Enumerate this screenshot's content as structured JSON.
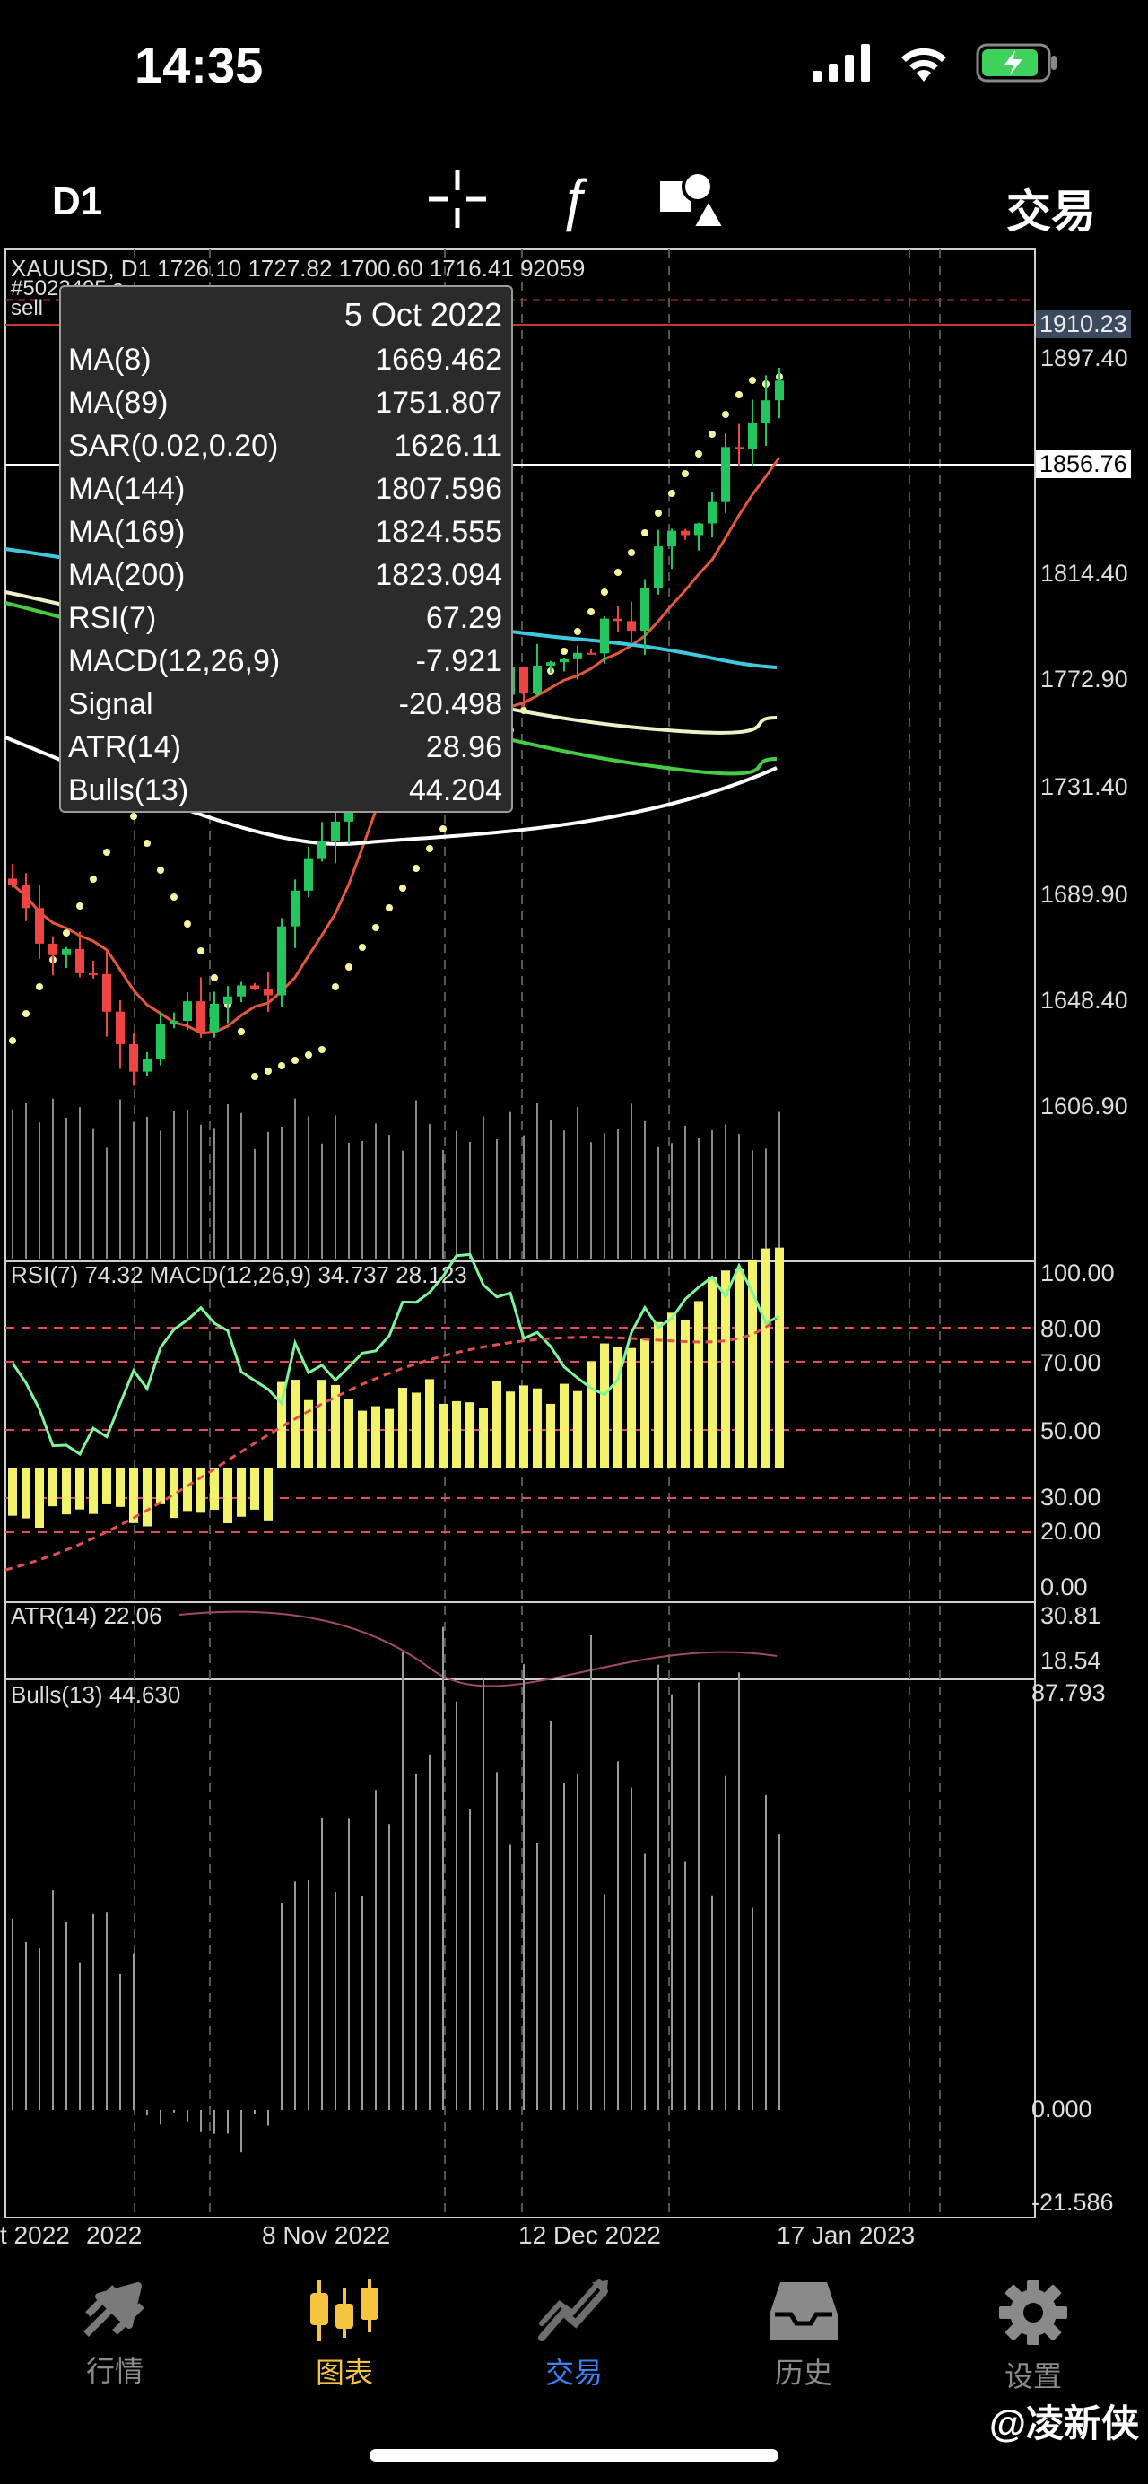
{
  "status": {
    "time": "14:35"
  },
  "toolbar": {
    "timeframe": "D1",
    "trade": "交易"
  },
  "chart": {
    "header": "XAUUSD, D1  1726.10 1727.82 1700.60 1716.41 92059",
    "header2": "#5023495 s",
    "header3": "sell",
    "price_labels": [
      "1910.23",
      "1897.40",
      "1856.76",
      "1814.40",
      "1772.90",
      "1731.40",
      "1689.90",
      "1648.40",
      "1606.90"
    ],
    "time_labels": [
      "t 2022",
      "2022",
      "8 Nov 2022",
      "12 Dec 2022",
      "17 Jan 2023"
    ]
  },
  "tooltip": {
    "date": "5 Oct 2022",
    "rows": [
      {
        "k": "MA(8)",
        "v": "1669.462"
      },
      {
        "k": "MA(89)",
        "v": "1751.807"
      },
      {
        "k": "SAR(0.02,0.20)",
        "v": "1626.11"
      },
      {
        "k": "MA(144)",
        "v": "1807.596"
      },
      {
        "k": "MA(169)",
        "v": "1824.555"
      },
      {
        "k": "MA(200)",
        "v": "1823.094"
      },
      {
        "k": "RSI(7)",
        "v": "67.29"
      },
      {
        "k": "MACD(12,26,9)",
        "v": "-7.921"
      },
      {
        "k": "Signal",
        "v": "-20.498"
      },
      {
        "k": "ATR(14)",
        "v": "28.96"
      },
      {
        "k": "Bulls(13)",
        "v": "44.204"
      }
    ]
  },
  "panels": {
    "rsi_title": "RSI(7) 74.32 MACD(12,26,9) 34.737 28.123",
    "rsi_levels": [
      "100.00",
      "80.00",
      "70.00",
      "50.00",
      "30.00",
      "20.00",
      "0.00"
    ],
    "atr_title": "ATR(14) 22.06",
    "atr_levels": [
      "30.81",
      "18.54"
    ],
    "bulls_title": "Bulls(13) 44.630",
    "bulls_levels": [
      "87.793",
      "0.000",
      "-21.586"
    ]
  },
  "nav": [
    {
      "label": "行情",
      "icon": "quotes-icon"
    },
    {
      "label": "图表",
      "icon": "chart-icon",
      "active": true
    },
    {
      "label": "交易",
      "icon": "trade-icon"
    },
    {
      "label": "历史",
      "icon": "history-icon"
    },
    {
      "label": "设置",
      "icon": "settings-icon"
    }
  ],
  "watermark": "@凌新侠",
  "colors": {
    "candle_up": "#22c55e",
    "candle_down": "#ef4444",
    "ma8": "#e4573d",
    "cyan": "#40c8e0",
    "sar": "#f5f5a0",
    "bar_yellow": "#f2f26b",
    "nav_active": "#f5c542",
    "nav_trade": "#3b82f6"
  }
}
